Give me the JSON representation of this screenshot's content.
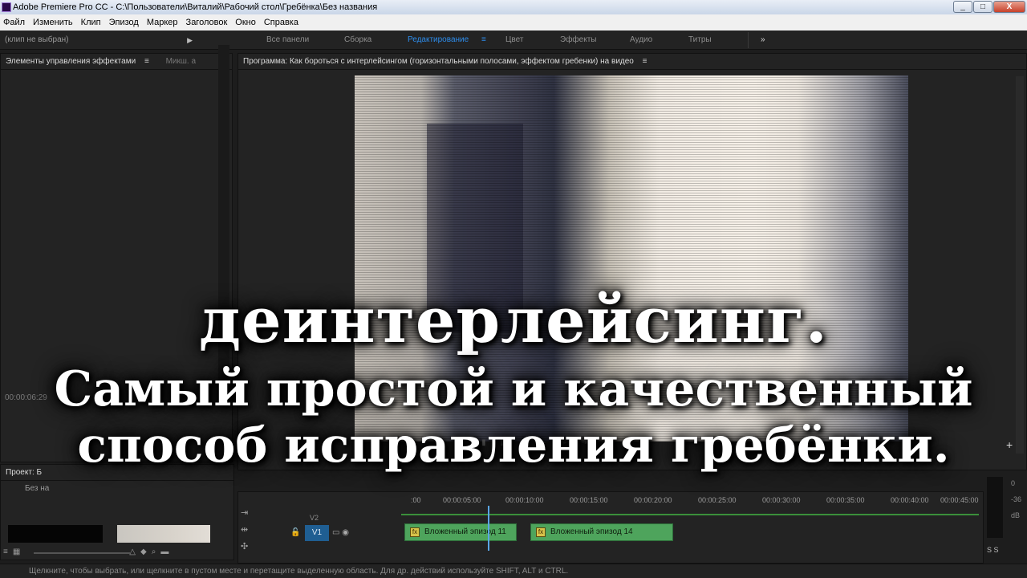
{
  "window": {
    "title": "Adobe Premiere Pro CC - C:\\Пользователи\\Виталий\\Рабочий стол\\Гребёнка\\Без названия",
    "minimize": "_",
    "maximize": "□",
    "close": "X"
  },
  "menu": [
    "Файл",
    "Изменить",
    "Клип",
    "Эпизод",
    "Маркер",
    "Заголовок",
    "Окно",
    "Справка"
  ],
  "workspaces": {
    "items": [
      "Все панели",
      "Сборка",
      "Редактирование",
      "Цвет",
      "Эффекты",
      "Аудио",
      "Титры"
    ],
    "active": "Редактирование",
    "more": "»",
    "menu": "≡"
  },
  "effect_controls": {
    "title": "Элементы управления эффектами",
    "menu": "≡",
    "second_tab": "Микш. а",
    "clip_status": "(клип не выбран)",
    "expand": "▶",
    "timecode": "00:00:06:29"
  },
  "program": {
    "title": "Программа: Как бороться с интерлейсингом (горизонтальными полосами, эффектом гребенки) на видео",
    "menu": "≡",
    "add": "+"
  },
  "project": {
    "title": "Проект: Б",
    "item": "Без на"
  },
  "timeline": {
    "ruler_ticks": [
      ":00",
      "00:00:05:00",
      "00:00:10:00",
      "00:00:15:00",
      "00:00:20:00",
      "00:00:25:00",
      "00:00:30:00",
      "00:00:35:00",
      "00:00:40:00",
      "00:00:45:00"
    ],
    "track_v2": "V2",
    "track_v1": "V1",
    "clips": [
      "Вложенный эпизод 11",
      "Вложенный эпизод 14"
    ],
    "fx": "fx"
  },
  "audio_meter": {
    "labels": [
      "0",
      "-36",
      "dB"
    ],
    "solo": "S S"
  },
  "status_bar": "Щелкните, чтобы выбрать, или щелкните в пустом месте и перетащите выделенную область. Для др. действий используйте SHIFT, ALT и CTRL.",
  "overlay": {
    "line1": "деинтерлейсинг.",
    "line2": "Самый простой и качественный",
    "line3": "способ исправления гребёнки."
  }
}
